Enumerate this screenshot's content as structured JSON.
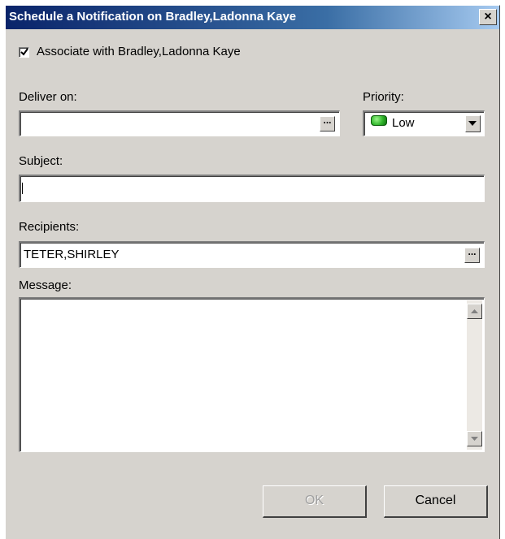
{
  "window": {
    "title": "Schedule a Notification on Bradley,Ladonna Kaye",
    "close_label": "×"
  },
  "associate": {
    "label": "Associate with Bradley,Ladonna Kaye",
    "checked": true
  },
  "deliver_on": {
    "label": "Deliver on:",
    "value": "",
    "browse_label": "..."
  },
  "priority": {
    "label": "Priority:",
    "value": "Low",
    "indicator_color": "#2fb52a"
  },
  "subject": {
    "label": "Subject:",
    "value": ""
  },
  "recipients": {
    "label": "Recipients:",
    "value": "TETER,SHIRLEY",
    "browse_label": "..."
  },
  "message": {
    "label": "Message:",
    "value": ""
  },
  "buttons": {
    "ok_label": "OK",
    "cancel_label": "Cancel"
  },
  "colors": {
    "dialog_bg": "#d6d3ce",
    "title_start": "#0a246a",
    "title_end": "#a6caf0"
  }
}
